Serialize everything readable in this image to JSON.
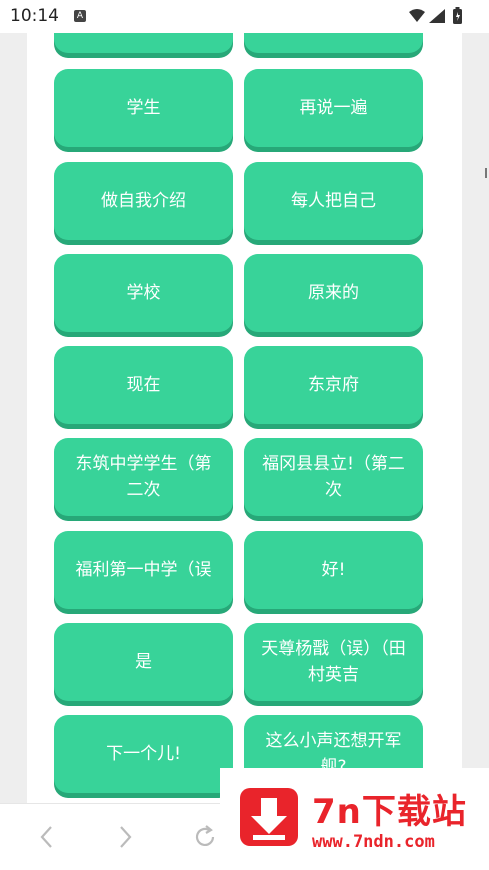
{
  "status_bar": {
    "time": "10:14",
    "notification_icon": "A",
    "icons": [
      "wifi-icon",
      "signal-icon",
      "battery-icon"
    ]
  },
  "buttons": [
    {
      "label": ""
    },
    {
      "label": ""
    },
    {
      "label": "学生"
    },
    {
      "label": "再说一遍"
    },
    {
      "label": "做自我介绍"
    },
    {
      "label": "每人把自己"
    },
    {
      "label": "学校"
    },
    {
      "label": "原来的"
    },
    {
      "label": "现在"
    },
    {
      "label": "东京府"
    },
    {
      "label": "东筑中学学生（第二次"
    },
    {
      "label": "福冈县县立!（第二次"
    },
    {
      "label": "福利第一中学（误"
    },
    {
      "label": "好!"
    },
    {
      "label": "是"
    },
    {
      "label": "天尊杨戬（误）（田村英吉"
    },
    {
      "label": "下一个儿!"
    },
    {
      "label": "这么小声还想开军舰?"
    }
  ],
  "nav": {
    "icons": [
      "back-icon",
      "forward-icon",
      "reload-icon"
    ]
  },
  "watermark": {
    "title": "7n下载站",
    "url": "www.7ndn.com"
  },
  "colors": {
    "button": "#38d399",
    "button_shadow": "#27a878",
    "watermark_red": "#e9242b"
  }
}
